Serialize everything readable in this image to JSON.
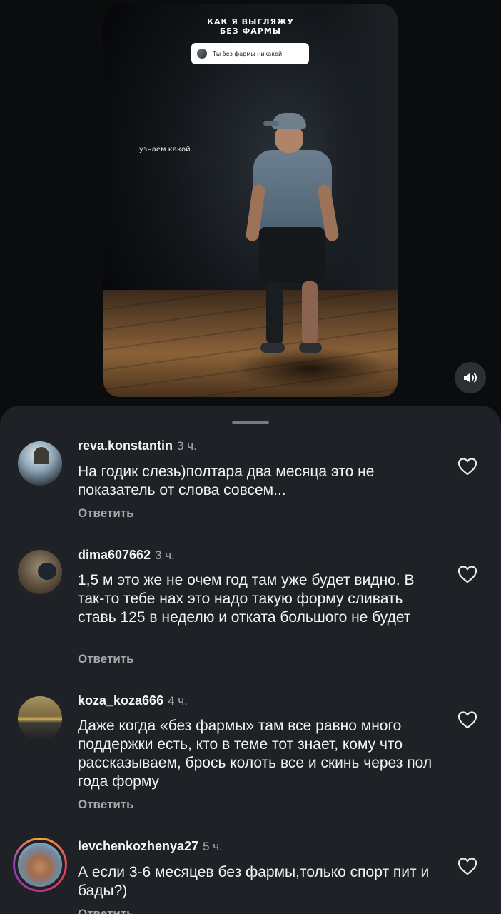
{
  "video": {
    "title_line1": "КАК Я ВЫГЛЯЖУ",
    "title_line2": "БЕЗ ФАРМЫ",
    "pill_text": "Ты без фармы никакой",
    "overlay_text": "узнаем какой"
  },
  "comments": [
    {
      "username": "reva.konstantin",
      "time": "3 ч.",
      "text": "На годик слезь)полтара два месяца это не показатель от слова совсем...",
      "reply_label": "Ответить"
    },
    {
      "username": "dima607662",
      "time": "3 ч.",
      "text": "1,5 м это же не очем год там уже будет видно. В так-то тебе нах это надо такую форму сливать ставь 125 в неделю и отката большого не будет",
      "reply_label": "Ответить"
    },
    {
      "username": "koza_koza666",
      "time": "4 ч.",
      "text": "Даже когда «без фармы» там все равно много поддержки есть, кто в теме тот знает, кому что рассказываем, брось колоть все и скинь через пол года форму",
      "reply_label": "Ответить"
    },
    {
      "username": "levchenkozhenya27",
      "time": "5 ч.",
      "text": "А если 3-6 месяцев без фармы,только спорт пит и бады?)",
      "reply_label": "Ответить"
    }
  ],
  "icons": {
    "sound": "speaker-icon",
    "like": "heart-outline-icon"
  }
}
